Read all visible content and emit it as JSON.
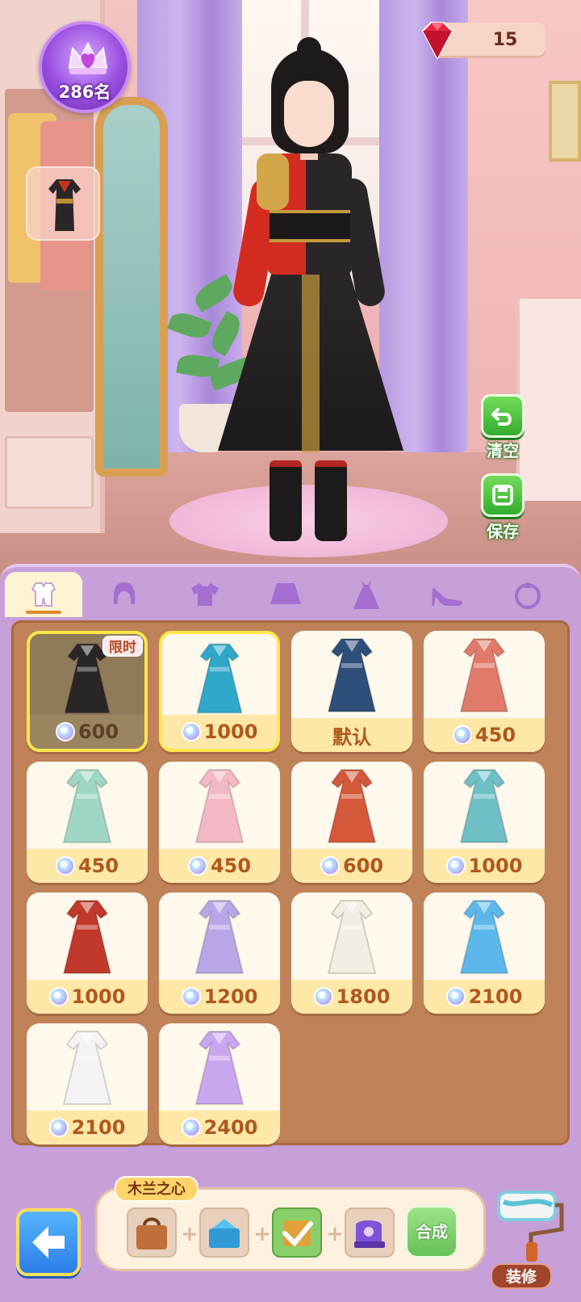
{
  "hud": {
    "rank_label": "286名",
    "gem_count": "15",
    "clear_label": "清空",
    "save_label": "保存"
  },
  "tabs": [
    {
      "name": "outfit",
      "icon": "full-outfit-icon",
      "active": true
    },
    {
      "name": "hair",
      "icon": "hair-icon",
      "active": false
    },
    {
      "name": "top",
      "icon": "shirt-icon",
      "active": false
    },
    {
      "name": "bottom",
      "icon": "skirt-icon",
      "active": false
    },
    {
      "name": "dress",
      "icon": "dress-icon",
      "active": false
    },
    {
      "name": "shoes",
      "icon": "high-heel-icon",
      "active": false
    },
    {
      "name": "accessory",
      "icon": "accessory-icon",
      "active": false
    }
  ],
  "items": [
    {
      "price": "600",
      "badge": "限时",
      "state": "equipped",
      "color": "#2a2628"
    },
    {
      "price": "1000",
      "state": "selected",
      "color": "#2fa8c9"
    },
    {
      "price": "默认",
      "state": "default",
      "color": "#2e4f7a"
    },
    {
      "price": "450",
      "color": "#e07a6a"
    },
    {
      "price": "450",
      "color": "#9fd6c6"
    },
    {
      "price": "450",
      "color": "#f3b9c6"
    },
    {
      "price": "600",
      "color": "#d4583a"
    },
    {
      "price": "1000",
      "color": "#6ec0c6"
    },
    {
      "price": "1000",
      "color": "#c0392b"
    },
    {
      "price": "1200",
      "color": "#b8a6e6"
    },
    {
      "price": "1800",
      "color": "#f1ede2"
    },
    {
      "price": "2100",
      "color": "#5cb8ea"
    },
    {
      "price": "2100",
      "color": "#f4f4f4"
    },
    {
      "price": "2400",
      "color": "#c9a7ef"
    }
  ],
  "synthesis": {
    "title": "木兰之心",
    "combine_label": "合成"
  },
  "decor_label": "装修",
  "colors": {
    "panel": "#c7a0d9",
    "grid_bg": "#c08258",
    "price_text": "#b0581e",
    "accent_green": "#34ad2e"
  }
}
